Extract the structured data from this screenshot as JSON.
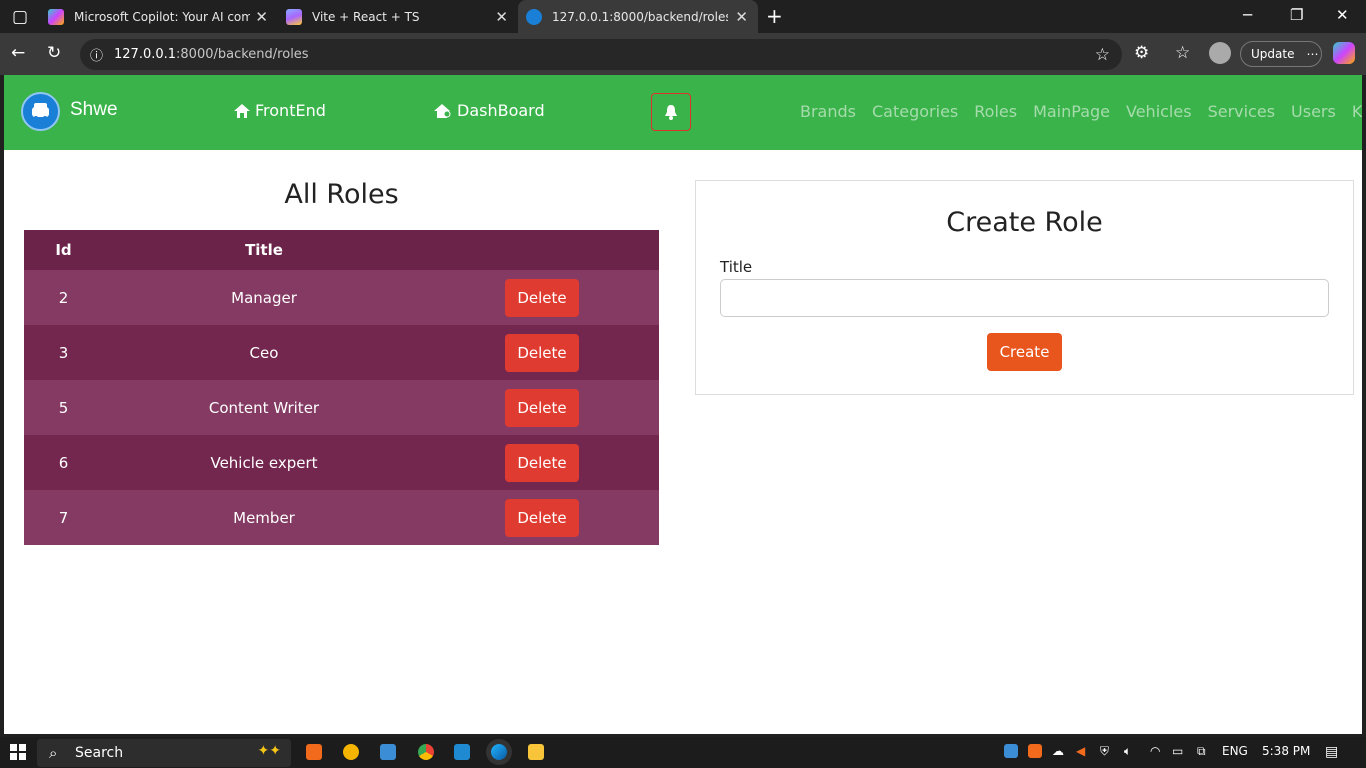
{
  "browser": {
    "tabs": [
      {
        "title": "Microsoft Copilot: Your AI compa",
        "icon": "copilot-icon"
      },
      {
        "title": "Vite + React + TS",
        "icon": "vite-icon"
      },
      {
        "title": "127.0.0.1:8000/backend/roles",
        "icon": "site-icon"
      }
    ],
    "url_host": "127.0.0.1",
    "url_path": ":8000/backend/roles",
    "update_label": "Update"
  },
  "nav": {
    "brand": "Shwe",
    "frontend": "FrontEnd",
    "dashboard": "DashBoard",
    "menu": [
      "Brands",
      "Categories",
      "Roles",
      "MainPage",
      "Vehicles",
      "Services",
      "Users",
      "Ko Ko"
    ]
  },
  "roles": {
    "heading": "All Roles",
    "columns": [
      "Id",
      "Title"
    ],
    "rows": [
      {
        "id": "2",
        "title": "Manager"
      },
      {
        "id": "3",
        "title": "Ceo"
      },
      {
        "id": "5",
        "title": "Content Writer"
      },
      {
        "id": "6",
        "title": "Vehicle expert"
      },
      {
        "id": "7",
        "title": "Member"
      }
    ],
    "delete_label": "Delete"
  },
  "create": {
    "heading": "Create Role",
    "label": "Title",
    "value": "",
    "button": "Create"
  },
  "taskbar": {
    "search": "Search",
    "lang": "ENG",
    "time": "5:38 PM"
  },
  "colors": {
    "nav": "#3ab44a",
    "table": "#73264e",
    "delete": "#e03b30",
    "create": "#e8561e"
  }
}
